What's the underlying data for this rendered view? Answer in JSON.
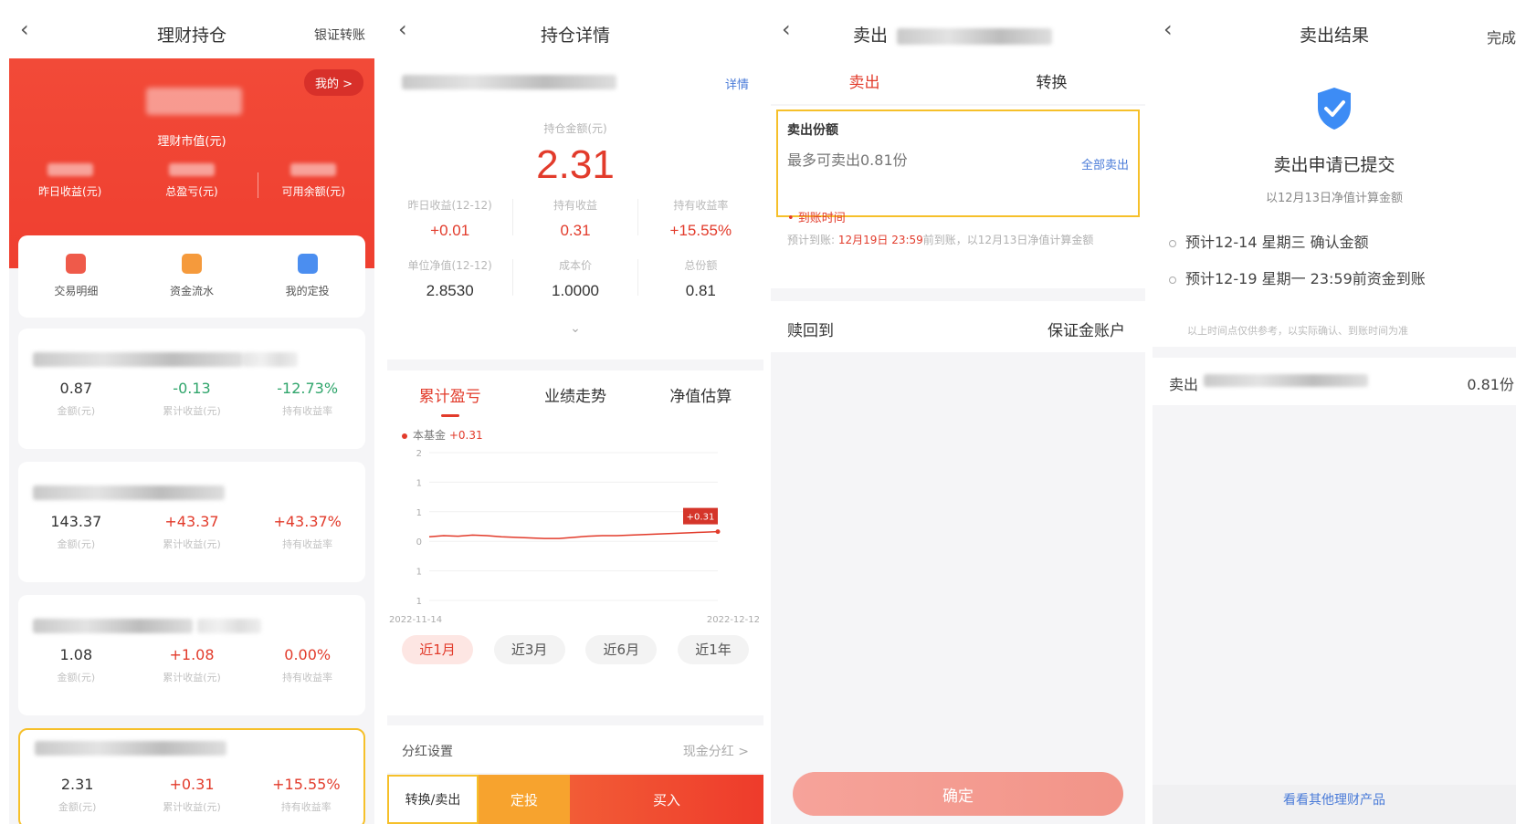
{
  "colors": {
    "accent": "#e23b2b",
    "gain": "#e23b2b",
    "loss": "#2fa56b",
    "highlight": "#f6c02a",
    "link": "#4a7bd8"
  },
  "p1": {
    "title": "理财持仓",
    "right": "银证转账",
    "my_badge": "我的 >",
    "market_label": "理财市值(元)",
    "hero_cols": [
      "昨日收益(元)",
      "总盈亏(元)",
      "可用余额(元)"
    ],
    "quick": [
      {
        "label": "交易明细",
        "icon": "receipt-icon"
      },
      {
        "label": "资金流水",
        "icon": "wallet-icon"
      },
      {
        "label": "我的定投",
        "icon": "shield-icon"
      }
    ],
    "holdings": [
      {
        "amount": "0.87",
        "profit": "-0.13",
        "rate": "-12.73%"
      },
      {
        "amount": "143.37",
        "profit": "+43.37",
        "rate": "+43.37%"
      },
      {
        "amount": "1.08",
        "profit": "+1.08",
        "rate": "0.00%"
      },
      {
        "amount": "2.31",
        "profit": "+0.31",
        "rate": "+15.55%"
      }
    ],
    "holding_labels": [
      "金额(元)",
      "累计收益(元)",
      "持有收益率"
    ]
  },
  "p2": {
    "title": "持仓详情",
    "detail": "详情",
    "amount_label": "持仓金额(元)",
    "amount": "2.31",
    "row1": [
      {
        "label": "昨日收益(12-12)",
        "value": "+0.01"
      },
      {
        "label": "持有收益",
        "value": "0.31"
      },
      {
        "label": "持有收益率",
        "value": "+15.55%"
      }
    ],
    "row2": [
      {
        "label": "单位净值(12-12)",
        "value": "2.8530"
      },
      {
        "label": "成本价",
        "value": "1.0000"
      },
      {
        "label": "总份额",
        "value": "0.81"
      }
    ],
    "tabs": [
      "累计盈亏",
      "业绩走势",
      "净值估算"
    ],
    "legend_name": "本基金",
    "legend_value": "+0.31",
    "ranges": [
      "近1月",
      "近3月",
      "近6月",
      "近1年"
    ],
    "dividend_label": "分红设置",
    "dividend_value": "现金分红 >",
    "btn_convert": "转换/卖出",
    "btn_plan": "定投",
    "btn_buy": "买入"
  },
  "chart_data": {
    "type": "line",
    "x_start": "2022-11-14",
    "x_end": "2022-12-12",
    "y_ticks": [
      "2",
      "1",
      "1",
      "0",
      "1",
      "1"
    ],
    "end_label": "+0.31",
    "series": [
      {
        "name": "本基金",
        "values": [
          0.22,
          0.24,
          0.23,
          0.25,
          0.24,
          0.22,
          0.21,
          0.2,
          0.19,
          0.19,
          0.21,
          0.23,
          0.24,
          0.24,
          0.25,
          0.26,
          0.27,
          0.28,
          0.29,
          0.3,
          0.31
        ]
      }
    ]
  },
  "p3": {
    "title": "卖出",
    "tabs": [
      "卖出",
      "转换"
    ],
    "sell_label": "卖出份额",
    "sell_placeholder": "最多可卖出0.81份",
    "sell_all": "全部卖出",
    "arrive_label": "• 到账时间",
    "arrive_prefix": "预计到账: ",
    "arrive_date": "12月19日 23:59",
    "arrive_suffix": "前到账，以12月13日净值计算金额",
    "redeem_label": "赎回到",
    "redeem_value": "保证金账户",
    "confirm": "确定"
  },
  "p4": {
    "title": "卖出结果",
    "right": "完成",
    "submitted": "卖出申请已提交",
    "note": "以12月13日净值计算金额",
    "steps": [
      "预计12-14 星期三 确认金额",
      "预计12-19 星期一 23:59前资金到账"
    ],
    "disclaimer": "以上时间点仅供参考，以实际确认、到账时间为准",
    "sold_label": "卖出",
    "sold_value": "0.81份",
    "more_link": "看看其他理财产品"
  }
}
